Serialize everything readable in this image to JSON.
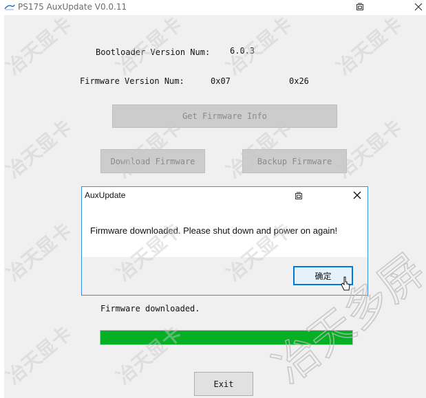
{
  "window": {
    "title": "PS175 AuxUpdate V0.0.11",
    "icons": [
      "app-icon",
      "restore-icon",
      "close-icon"
    ]
  },
  "info": {
    "bootloader_label": "Bootloader Version Num:",
    "bootloader_value": "6.0.3",
    "firmware_label": "Firmware Version Num:",
    "firmware_value_1": "0x07",
    "firmware_value_2": "0x26"
  },
  "buttons": {
    "get_firmware_info": "Get Firmware Info",
    "download_firmware": "Download Firmware",
    "backup_firmware": "Backup Firmware",
    "exit": "Exit"
  },
  "status": {
    "text": "Firmware downloaded.",
    "progress_fraction": 1.0,
    "progress_color": "#06b025"
  },
  "dialog": {
    "title": "AuxUpdate",
    "message": "Firmware downloaded. Please shut down and power on again!",
    "ok_label": "确定",
    "accent_color": "#0078d7"
  },
  "watermark": {
    "tile_text": "冶天显卡",
    "large_text": "冶天多屏"
  }
}
